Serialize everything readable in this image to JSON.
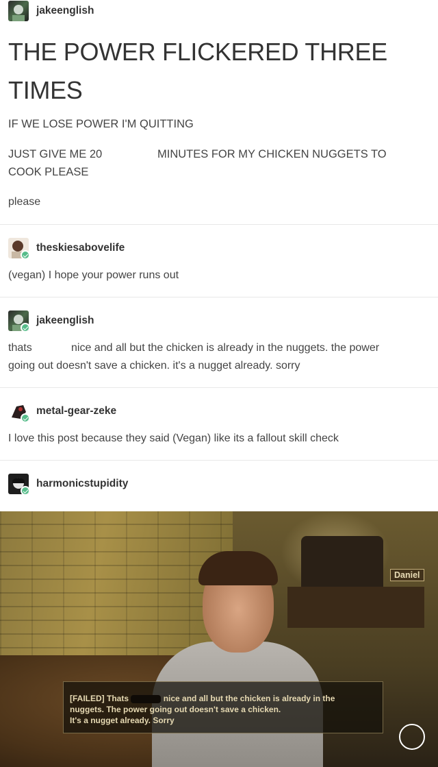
{
  "posts": [
    {
      "username": "jakeenglish",
      "avatar": "avatar-jakeenglish",
      "title": "THE POWER FLICKERED THREE TIMES",
      "lines": [
        "IF WE LOSE POWER I'M QUITTING",
        "JUST GIVE ME 20",
        "MINUTES FOR MY CHICKEN NUGGETS TO",
        "COOK PLEASE",
        "please"
      ]
    },
    {
      "username": "theskiesabovelife",
      "avatar": "avatar-theskiesabovelife",
      "text": "(vegan) I hope your power runs out"
    },
    {
      "username": "jakeenglish",
      "avatar": "avatar-jakeenglish",
      "text_line1_a": "thats",
      "text_line1_b": "nice and all but the chicken is already in the nuggets. the power",
      "text_line2": "going out doesn't save a chicken. it's a nugget already. sorry"
    },
    {
      "username": "metal-gear-zeke",
      "avatar": "avatar-metal-gear-zeke",
      "text": "I love this post because they said (Vegan) like its a fallout skill check"
    },
    {
      "username": "harmonicstupidity",
      "avatar": "avatar-harmonicstupidity"
    }
  ],
  "video": {
    "speaker": "Daniel",
    "dialogue_line1_a": "[FAILED] Thats",
    "dialogue_line1_b": "nice and all but the chicken is already in the",
    "dialogue_line2": "nuggets. The power going out doesn't save a chicken.",
    "dialogue_line3": "It's a nugget already. Sorry",
    "continue_icon": "circle-icon"
  },
  "colors": {
    "reblog_badge": "#56bc8a",
    "text": "#444444",
    "divider": "#e8e8e8"
  }
}
